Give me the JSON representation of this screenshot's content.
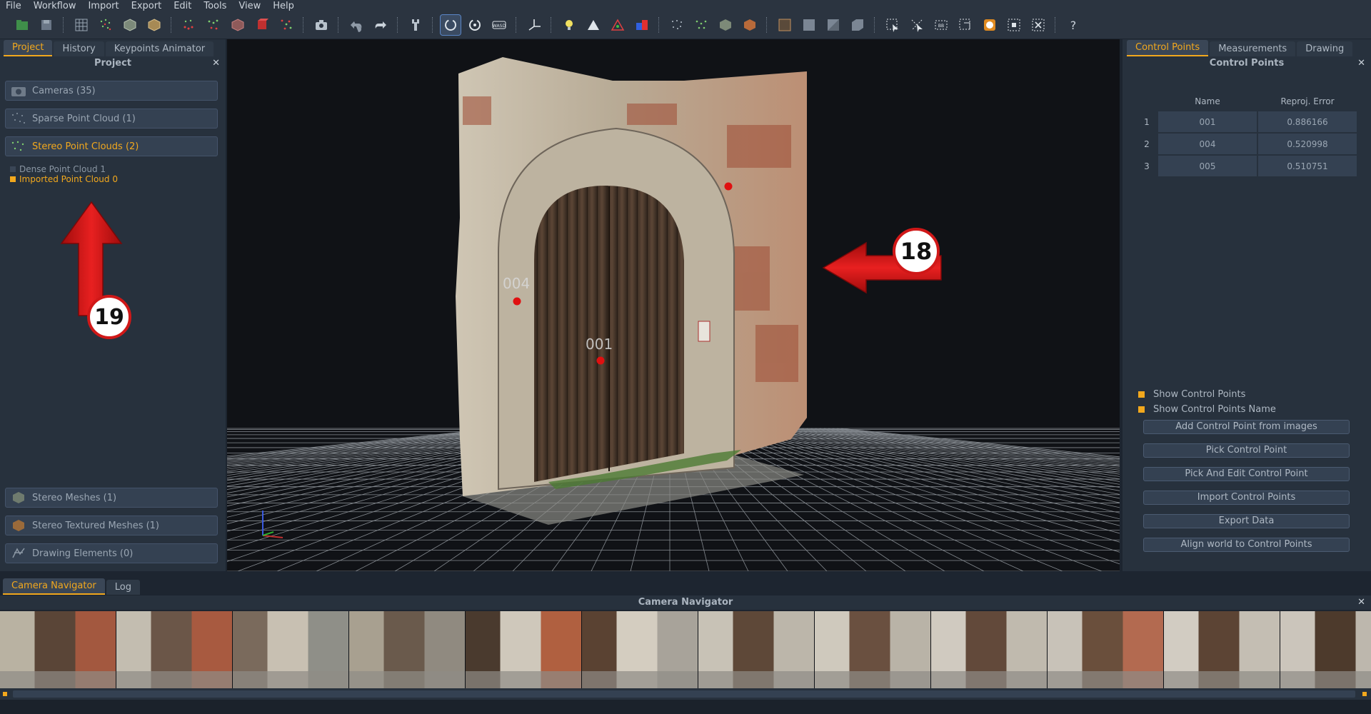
{
  "menu": [
    "File",
    "Workflow",
    "Import",
    "Export",
    "Edit",
    "Tools",
    "View",
    "Help"
  ],
  "toolbar_icons": [
    "new-project-icon",
    "save-icon",
    "grid-icon",
    "sparse-cloud-icon",
    "mesh-icon",
    "textured-mesh-icon",
    "cloud-red-icon",
    "cloud-green-icon",
    "mesh-red-icon",
    "cube-red-icon",
    "cloud-filter-icon",
    "camera-icon",
    "undo-icon",
    "redo-icon",
    "tool-icon",
    "orbit-icon",
    "rotate-icon",
    "wasd-icon",
    "axes-icon",
    "light-icon",
    "shading-icon",
    "normals-icon",
    "color-icon",
    "points-icon",
    "points-green-icon",
    "box-icon",
    "box-red-icon",
    "frame-icon",
    "select-icon",
    "select-alt-icon",
    "select-sub-icon",
    "lasso-icon",
    "select-all-icon",
    "invert-selection-icon",
    "measure-icon",
    "bbox-icon",
    "delete-selection-icon",
    "help-icon"
  ],
  "left": {
    "tabs": [
      "Project",
      "History",
      "Keypoints Animator"
    ],
    "title": "Project",
    "items": [
      {
        "label": "Cameras (35)",
        "icon": "camera-icon"
      },
      {
        "label": "Sparse Point Cloud (1)",
        "icon": "sparse-cloud-icon"
      },
      {
        "label": "Stereo Point Clouds (2)",
        "icon": "stereo-cloud-icon"
      }
    ],
    "subitems": [
      {
        "label": "Dense Point Cloud 1",
        "color": "#3a4656",
        "text_color": "#8a96a3"
      },
      {
        "label": "Imported Point Cloud 0",
        "color": "#f2a81d",
        "text_color": "#f2a81d"
      }
    ],
    "bottom_items": [
      {
        "label": "Stereo Meshes (1)",
        "icon": "mesh-icon"
      },
      {
        "label": "Stereo Textured Meshes (1)",
        "icon": "textured-mesh-icon"
      },
      {
        "label": "Drawing Elements (0)",
        "icon": "drawing-icon"
      }
    ]
  },
  "viewport": {
    "points": [
      {
        "label": "004"
      },
      {
        "label": "001"
      }
    ],
    "annotations": [
      "18",
      "19"
    ]
  },
  "right": {
    "tabs": [
      "Control Points",
      "Measurements",
      "Drawing"
    ],
    "title": "Control Points",
    "columns": [
      "Name",
      "Reproj. Error"
    ],
    "rows": [
      {
        "idx": "1",
        "name": "001",
        "error": "0.886166"
      },
      {
        "idx": "2",
        "name": "004",
        "error": "0.520998"
      },
      {
        "idx": "3",
        "name": "005",
        "error": "0.510751"
      }
    ],
    "checkboxes": [
      "Show Control Points",
      "Show Control Points Name"
    ],
    "buttons": [
      "Add Control Point from images",
      "Pick Control Point",
      "Pick And Edit Control Point",
      "Import Control Points",
      "Export Data",
      "Align world to Control Points"
    ]
  },
  "navigator": {
    "tabs": [
      "Camera Navigator",
      "Log"
    ],
    "title": "Camera Navigator"
  },
  "colors": {
    "accent": "#f2a81d",
    "control_point": "#e01010",
    "annotation_red": "#d01818"
  }
}
